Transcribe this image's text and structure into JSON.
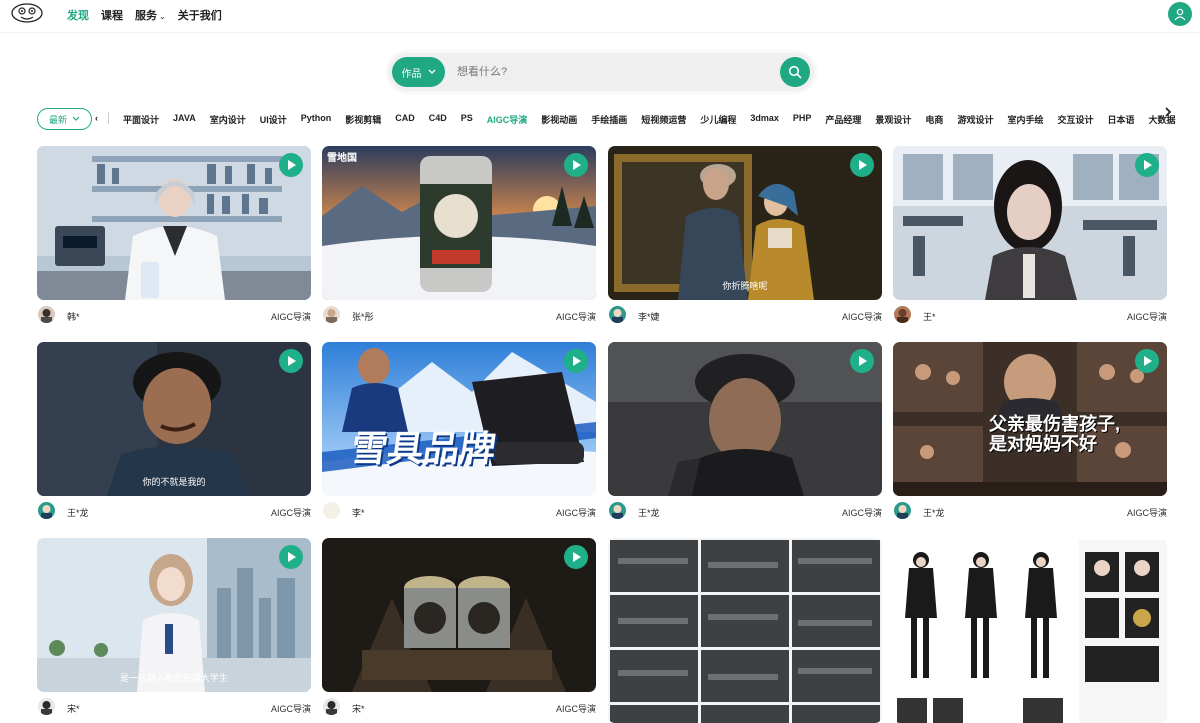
{
  "nav": {
    "items": [
      {
        "label": "发现",
        "active": true
      },
      {
        "label": "课程",
        "active": false
      },
      {
        "label": "服务",
        "active": false,
        "has_dropdown": true
      },
      {
        "label": "关于我们",
        "active": false
      }
    ]
  },
  "search": {
    "type_label": "作品",
    "placeholder": "想看什么?"
  },
  "filter": {
    "sort_label": "最新",
    "categories": [
      "平面设计",
      "JAVA",
      "室内设计",
      "UI设计",
      "Python",
      "影视剪辑",
      "CAD",
      "C4D",
      "PS",
      "AIGC导演",
      "影视动画",
      "手绘插画",
      "短视频运营",
      "少儿编程",
      "3dmax",
      "PHP",
      "产品经理",
      "景观设计",
      "电商",
      "游戏设计",
      "室内手绘",
      "交互设计",
      "日本语",
      "大数据"
    ],
    "active_category": "AIGC导演"
  },
  "cards": [
    {
      "author": "韩*",
      "tag": "AIGC导演",
      "caption": ""
    },
    {
      "author": "张*彤",
      "tag": "AIGC导演",
      "caption": ""
    },
    {
      "author": "李*婕",
      "tag": "AIGC导演",
      "caption": "你折腾啥呢"
    },
    {
      "author": "王*",
      "tag": "AIGC导演",
      "caption": ""
    },
    {
      "author": "王*龙",
      "tag": "AIGC导演",
      "caption": "你的不就是我的"
    },
    {
      "author": "李*",
      "tag": "AIGC导演",
      "caption": ""
    },
    {
      "author": "王*龙",
      "tag": "AIGC导演",
      "caption": ""
    },
    {
      "author": "王*龙",
      "tag": "AIGC导演",
      "caption": ""
    },
    {
      "author": "宋*",
      "tag": "AIGC导演",
      "caption": "是一名刚入职的应届大学生"
    },
    {
      "author": "宋*",
      "tag": "AIGC导演",
      "caption": ""
    }
  ],
  "thumb_text": {
    "snow_brand": "雪具品牌",
    "drama_line1": "父亲最伤害孩子,",
    "drama_line2": "是对妈妈不好",
    "snow_logo": "雪地国"
  },
  "colors": {
    "accent": "#1fa882"
  }
}
